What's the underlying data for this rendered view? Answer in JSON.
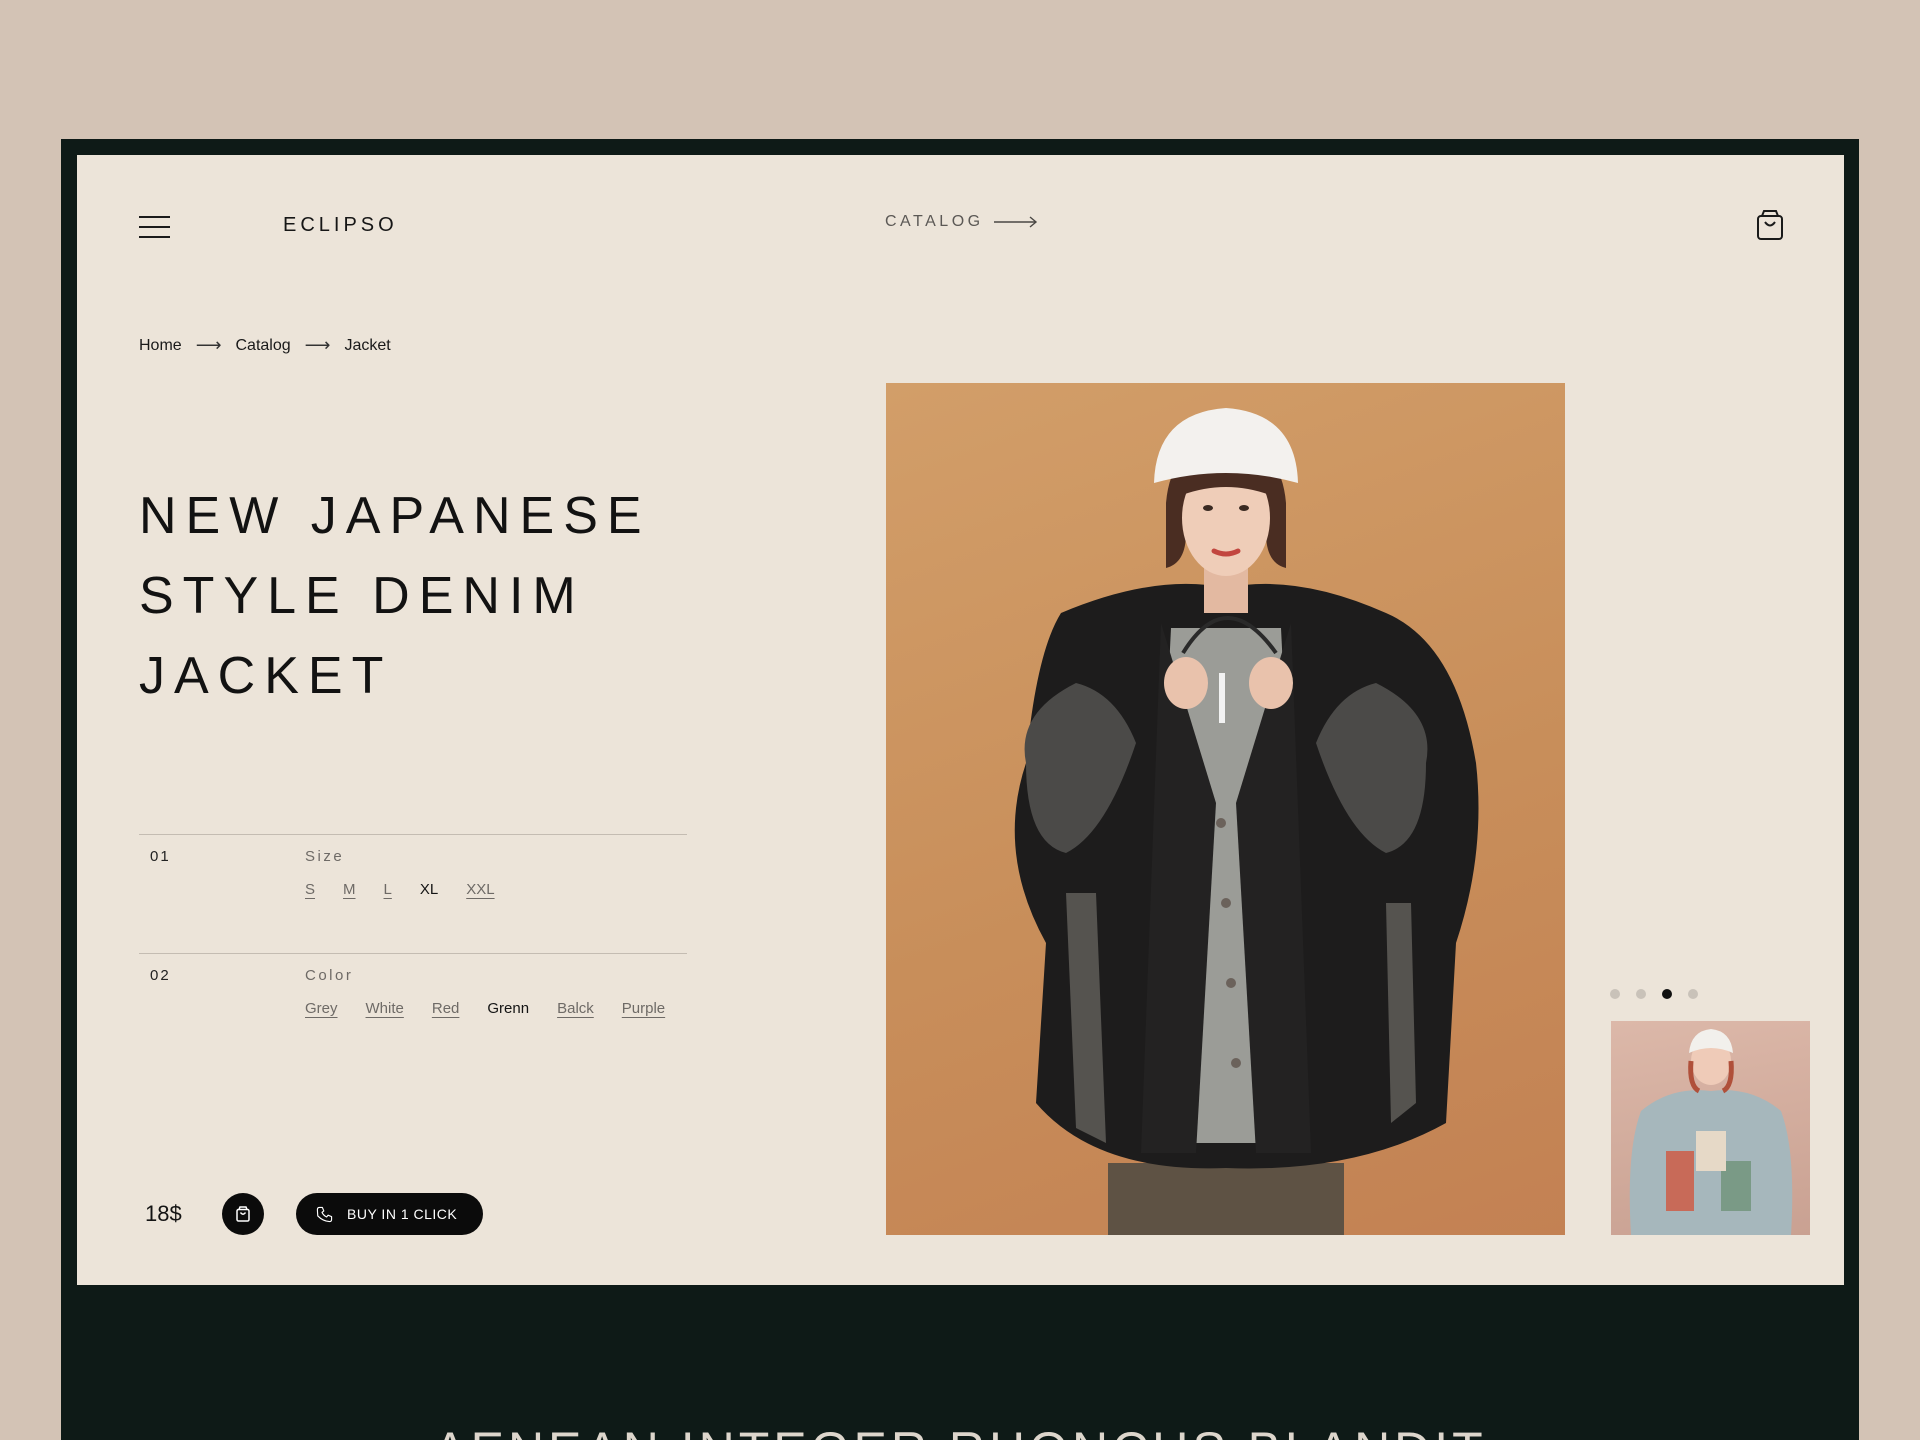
{
  "header": {
    "brand": "ECLIPSO",
    "catalog_link": "CATALOG"
  },
  "breadcrumb": [
    "Home",
    "Catalog",
    "Jacket"
  ],
  "product": {
    "title_lines": [
      "NEW JAPANESE",
      "STYLE DENIM",
      "JACKET"
    ],
    "price": "18$",
    "buy_label": "BUY IN 1 CLICK"
  },
  "options": [
    {
      "number": "01",
      "label": "Size",
      "values": [
        "S",
        "M",
        "L",
        "XL",
        "XXL"
      ],
      "selected": "XL"
    },
    {
      "number": "02",
      "label": "Color",
      "values": [
        "Grey",
        "White",
        "Red",
        "Grenn",
        "Balck",
        "Purple"
      ],
      "selected": "Grenn"
    }
  ],
  "gallery": {
    "dot_count": 4,
    "active_dot": 3
  },
  "footer": {
    "teaser": "AENEAN INTEGER RHONCUS BLANDIT"
  },
  "colors": {
    "page_bg": "#d3c3b5",
    "frame": "#0e1a17",
    "card": "#ece4d9",
    "accent": "#0b0b0b",
    "photo_bg": "#cd9460"
  },
  "icons": [
    "menu-icon",
    "arrow-right-icon",
    "shopping-bag-icon",
    "phone-icon"
  ]
}
